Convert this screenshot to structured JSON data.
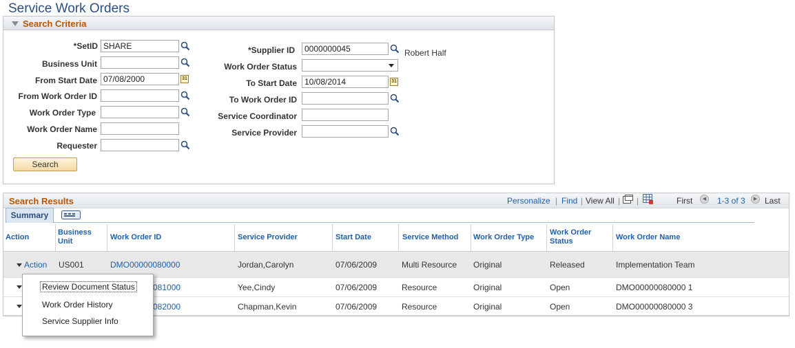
{
  "page": {
    "title": "Service Work Orders"
  },
  "search_criteria": {
    "title": "Search Criteria",
    "setid": {
      "label": "*SetID",
      "value": "SHARE"
    },
    "business_unit": {
      "label": "Business Unit",
      "value": ""
    },
    "from_start_date": {
      "label": "From Start Date",
      "value": "07/08/2000"
    },
    "from_work_order_id": {
      "label": "From Work Order ID",
      "value": ""
    },
    "work_order_type": {
      "label": "Work Order Type",
      "value": ""
    },
    "work_order_name": {
      "label": "Work Order Name",
      "value": ""
    },
    "requester": {
      "label": "Requester",
      "value": ""
    },
    "supplier_id": {
      "label": "*Supplier ID",
      "value": "0000000045",
      "description": "Robert Half"
    },
    "work_order_status": {
      "label": "Work Order Status",
      "value": ""
    },
    "to_start_date": {
      "label": "To Start Date",
      "value": "10/08/2014"
    },
    "to_work_order_id": {
      "label": "To Work Order ID",
      "value": ""
    },
    "service_coordinator": {
      "label": "Service Coordinator",
      "value": ""
    },
    "service_provider": {
      "label": "Service Provider",
      "value": ""
    },
    "search_button": "Search",
    "calendar_glyph": "31"
  },
  "results": {
    "title": "Search Results",
    "personalize": "Personalize",
    "find": "Find",
    "sep": "|",
    "view_all": "View All",
    "first": "First",
    "range": "1-3 of 3",
    "last": "Last",
    "tab": "Summary",
    "columns": {
      "action": "Action",
      "business_unit_1": "Business",
      "business_unit_2": "Unit",
      "work_order_id": "Work Order ID",
      "service_provider": "Service Provider",
      "start_date": "Start Date",
      "service_method": "Service Method",
      "work_order_type": "Work Order Type",
      "work_order_status_1": "Work Order",
      "work_order_status_2": "Status",
      "work_order_name": "Work Order Name"
    },
    "rows": [
      {
        "action": "Action",
        "business_unit": "US001",
        "work_order_id": "DMO00000080000",
        "service_provider": "Jordan,Carolyn",
        "start_date": "07/06/2009",
        "service_method": "Multi Resource",
        "work_order_type": "Original",
        "status": "Released",
        "name": "Implementation Team"
      },
      {
        "action": "",
        "business_unit": "",
        "work_order_id_fragment": "081000",
        "service_provider": "Yee,Cindy",
        "start_date": "07/06/2009",
        "service_method": "Resource",
        "work_order_type": "Original",
        "status": "Open",
        "name": "DMO00000080000 1"
      },
      {
        "action": "",
        "business_unit": "",
        "work_order_id_fragment": "082000",
        "service_provider": "Chapman,Kevin",
        "start_date": "07/06/2009",
        "service_method": "Resource",
        "work_order_type": "Original",
        "status": "Open",
        "name": "DMO00000080000 3"
      }
    ]
  },
  "action_menu": {
    "items": [
      "Review Document Status",
      "Work Order History",
      "Service Supplier Info"
    ]
  },
  "colors": {
    "title": "#2c4e7c",
    "section_title": "#bb5500",
    "link": "#1f5ea8"
  }
}
